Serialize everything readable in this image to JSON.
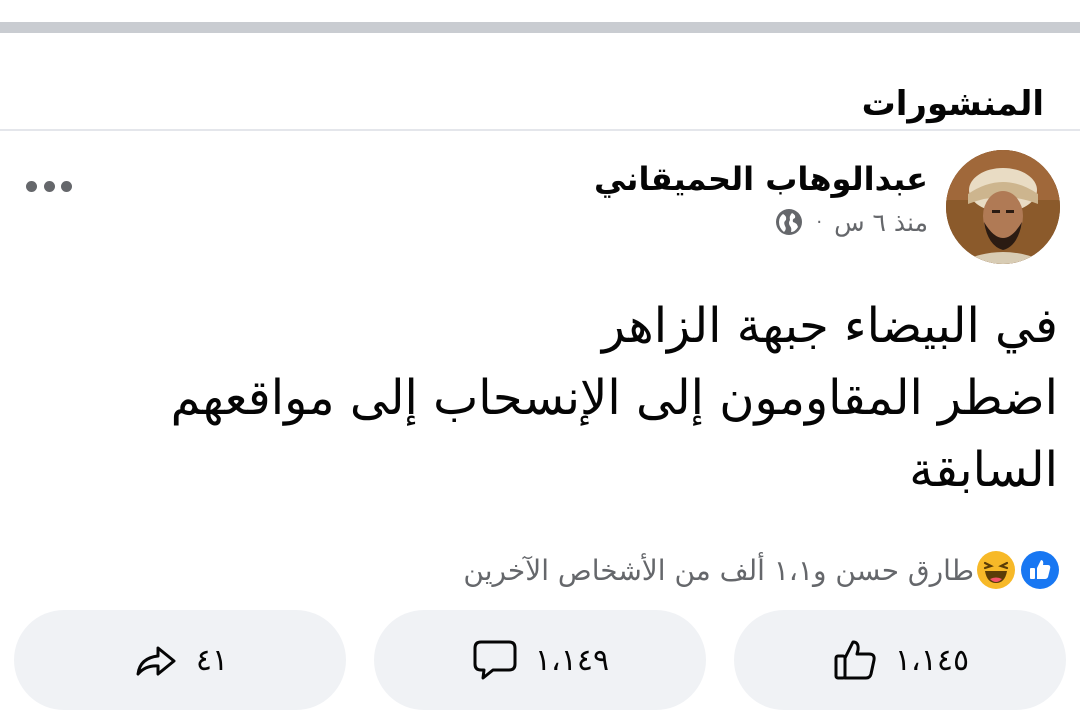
{
  "section": {
    "title": "المنشورات"
  },
  "post": {
    "author": "عبدالوهاب الحميقاني",
    "time": "منذ ٦ س",
    "separator": "·",
    "text_lines": [
      "في البيضاء جبهة الزاهر",
      "اضطر المقاومون إلى الإنسحاب إلى مواقعهم",
      "السابقة"
    ],
    "reactions_summary": "طارق حسن و١،١ ألف من الأشخاص الآخرين",
    "reaction_icons": [
      "like-reaction",
      "haha-reaction"
    ]
  },
  "actions": {
    "like_count": "١،١٤٥",
    "comment_count": "١،١٤٩",
    "share_count": "٤١"
  },
  "colors": {
    "text": "#050505",
    "secondary": "#65676b",
    "pill_bg": "#f0f2f5",
    "like_blue": "#1877f2",
    "haha_yellow": "#f7b928"
  },
  "icons": {
    "more": "more-horizontal-icon",
    "privacy": "globe-icon",
    "like": "thumbs-up-icon",
    "comment": "comment-bubble-icon",
    "share": "share-arrow-icon"
  }
}
